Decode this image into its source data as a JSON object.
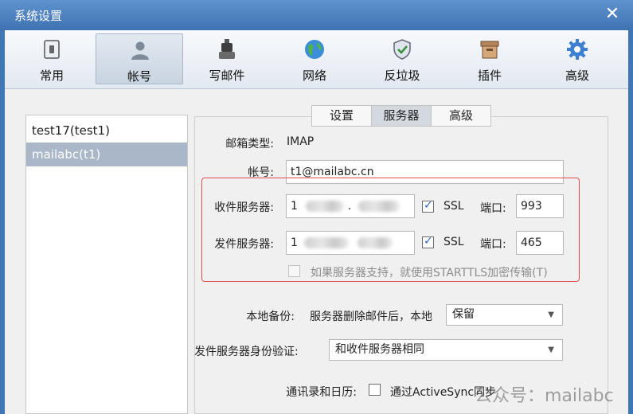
{
  "window": {
    "title": "系统设置",
    "close_glyph": "✕"
  },
  "toolbar": {
    "items": [
      {
        "label": "常用",
        "icon": "general-icon"
      },
      {
        "label": "帐号",
        "icon": "user-icon"
      },
      {
        "label": "写邮件",
        "icon": "compose-icon"
      },
      {
        "label": "网络",
        "icon": "globe-icon"
      },
      {
        "label": "反垃圾",
        "icon": "shield-icon"
      },
      {
        "label": "插件",
        "icon": "box-icon"
      },
      {
        "label": "高级",
        "icon": "gear-icon"
      }
    ],
    "active_index": 1
  },
  "accounts": [
    {
      "label": "test17(test1)"
    },
    {
      "label": "mailabc(t1)"
    }
  ],
  "selected_account": 1,
  "tabs": [
    {
      "label": "设置"
    },
    {
      "label": "服务器"
    },
    {
      "label": "高级"
    }
  ],
  "active_tab": 1,
  "form": {
    "mailbox_type_label": "邮箱类型:",
    "mailbox_type_value": "IMAP",
    "account_label": "帐号:",
    "account_value": "t1@mailabc.cn",
    "incoming_label": "收件服务器:",
    "incoming_prefix": "1",
    "incoming_dot": ".",
    "outgoing_label": "发件服务器:",
    "outgoing_prefix": "1",
    "ssl_label": "SSL",
    "port_label": "端口:",
    "incoming_port": "993",
    "outgoing_port": "465",
    "starttls_label": "如果服务器支持，就使用STARTTLS加密传输(T)",
    "backup_label": "本地备份:",
    "backup_desc": "服务器删除邮件后，本地",
    "backup_value": "保留",
    "smtp_auth_label": "发件服务器身份验证:",
    "smtp_auth_value": "和收件服务器相同",
    "contacts_label": "通讯录和日历:",
    "activesync_label": "通过ActiveSync同步"
  },
  "watermark": "公众号：mailabc",
  "colors": {
    "highlight": "#e34b4b",
    "selected": "#a9b7c8",
    "titlebar": "#3e72b1"
  }
}
